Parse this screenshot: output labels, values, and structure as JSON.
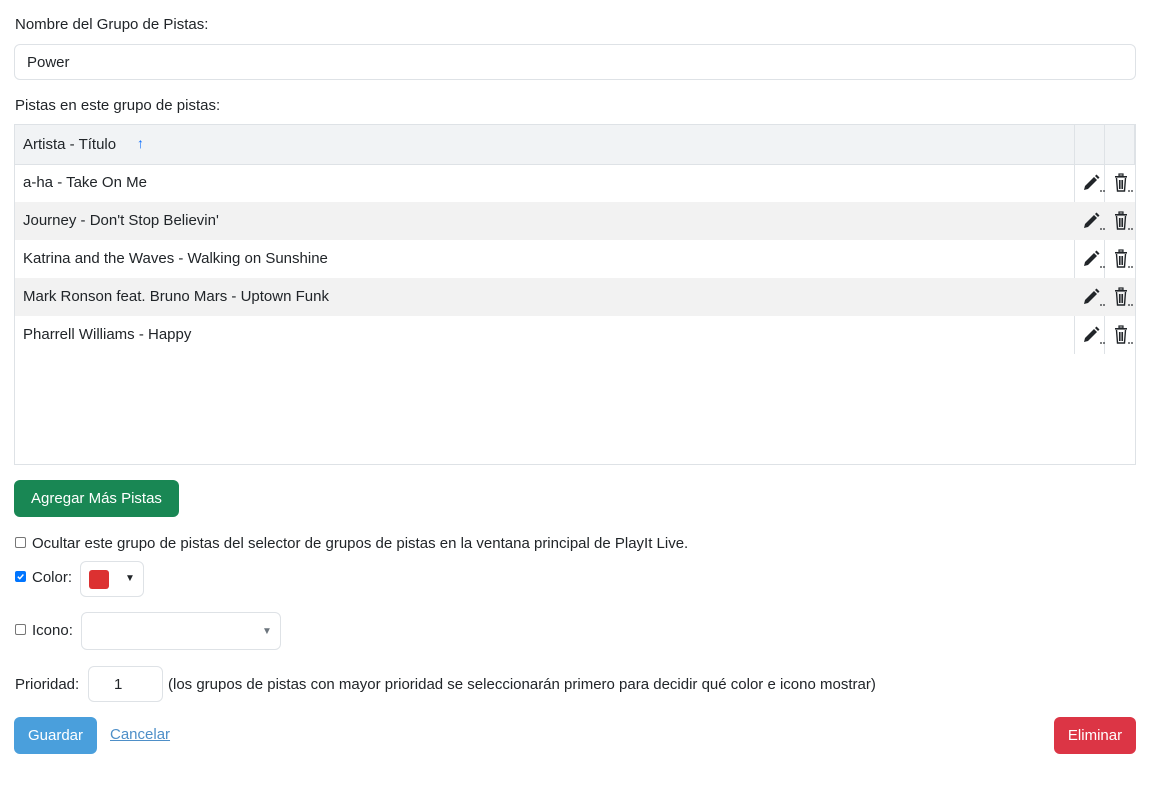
{
  "group_name": {
    "label": "Nombre del Grupo de Pistas:",
    "value": "Power"
  },
  "tracks_section": {
    "label": "Pistas en este grupo de pistas:",
    "column_header": "Artista - Título",
    "sort_indicator": "↑",
    "rows": [
      {
        "title": "a-ha - Take On Me"
      },
      {
        "title": "Journey - Don't Stop Believin'"
      },
      {
        "title": "Katrina and the Waves - Walking on Sunshine"
      },
      {
        "title": "Mark Ronson feat. Bruno Mars - Uptown Funk"
      },
      {
        "title": "Pharrell Williams - Happy"
      }
    ]
  },
  "add_tracks_button": {
    "label": "Agregar Más Pistas",
    "color": "#198754"
  },
  "hide_option": {
    "checked": false,
    "label": "Ocultar este grupo de pistas del selector de grupos de pistas en la ventana principal de PlayIt Live."
  },
  "color_option": {
    "checked": true,
    "label": "Color:",
    "selected_color": "#dc3131"
  },
  "icon_option": {
    "checked": false,
    "label": "Icono:",
    "selected": ""
  },
  "priority": {
    "label": "Prioridad:",
    "value": "1",
    "hint": "(los grupos de pistas con mayor prioridad se seleccionarán primero para decidir qué color e icono mostrar)"
  },
  "actions": {
    "save_label": "Guardar",
    "save_color": "#4a9fdc",
    "cancel_label": "Cancelar",
    "delete_label": "Eliminar",
    "delete_color": "#dc3545"
  },
  "icons": {
    "edit": "pencil-icon",
    "delete": "trash-icon",
    "dropdown": "caret-down-icon"
  }
}
